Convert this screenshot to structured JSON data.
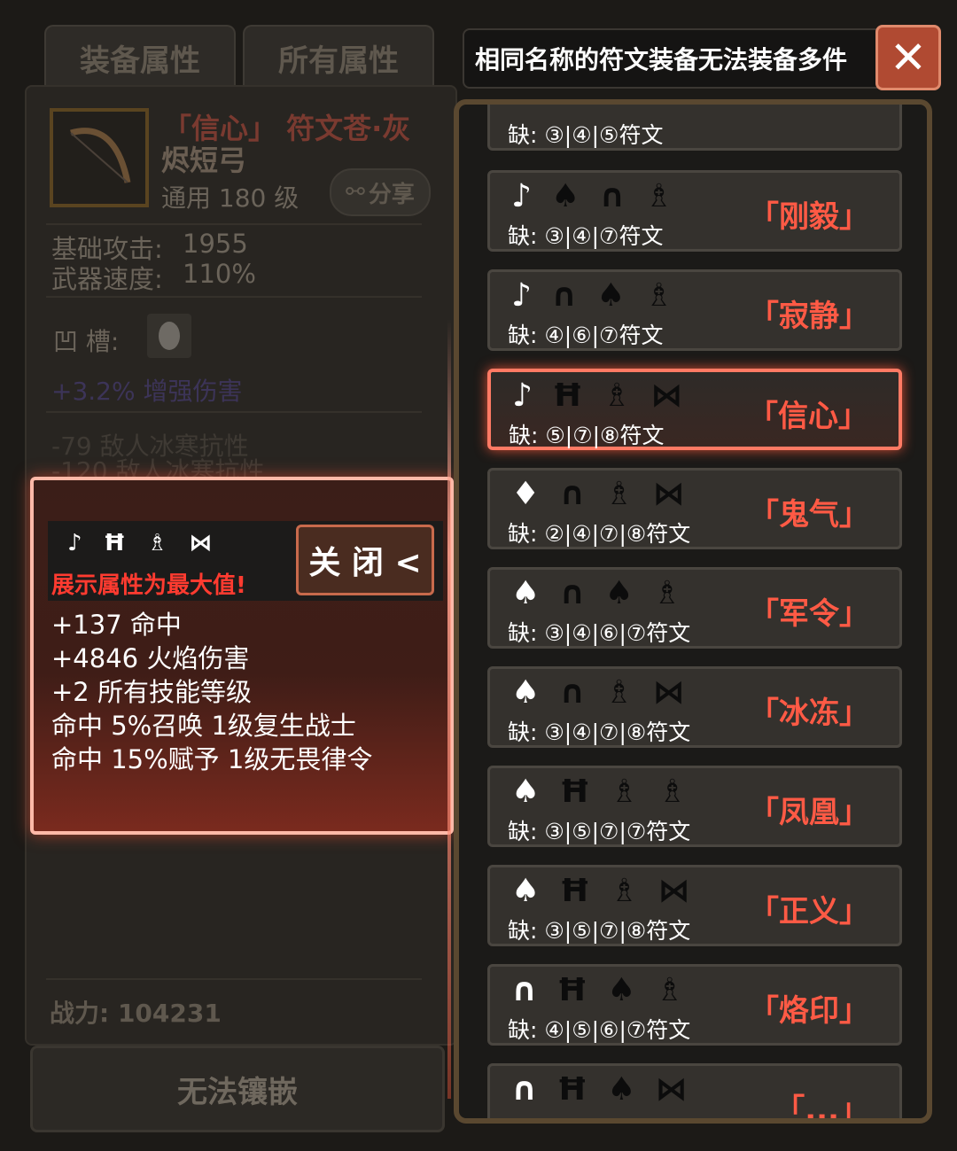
{
  "tabs": [
    {
      "label": "装备属性"
    },
    {
      "label": "所有属性"
    }
  ],
  "item": {
    "name_line1": "「信心」 符文苍·灰",
    "name_line2": "烬短弓",
    "level": "通用 180 级",
    "share_label": "分享",
    "base_attack_label": "基础攻击:",
    "base_attack_value": "1955",
    "weapon_speed_label": "武器速度:",
    "weapon_speed_value": "110%",
    "socket_label": "凹 槽:",
    "enhance": "+3.2% 增强伤害",
    "ice_resist_1": "-79 敌人冰寒抗性",
    "ice_resist_2": "-120 敌人冰寒抗性",
    "power": "战力: 104231",
    "cannot_inlay": "无法镶嵌"
  },
  "popup": {
    "runes": [
      "♪",
      "Ħ",
      "♗",
      "⋈"
    ],
    "max_note": "展示属性为最大值!",
    "close_label": "关 闭 <",
    "attributes": [
      "+137 命中",
      "+4846 火焰伤害",
      "+2 所有技能等级",
      "命中 5%召唤 1级复生战士",
      "命中 15%赋予 1级无畏律令"
    ]
  },
  "header": {
    "warning": "相同名称的符文装备无法装备多件",
    "close_icon": "✕"
  },
  "list": [
    {
      "runes": [
        "",
        "",
        "",
        ""
      ],
      "missing": "缺: ③|④|⑤符文",
      "name": "",
      "selected": false
    },
    {
      "runes": [
        "♪",
        "♠",
        "∩",
        "♗"
      ],
      "missing": "缺: ③|④|⑦符文",
      "name": "「刚毅」",
      "selected": false
    },
    {
      "runes": [
        "♪",
        "∩",
        "♠",
        "♗"
      ],
      "missing": "缺: ④|⑥|⑦符文",
      "name": "「寂静」",
      "selected": false
    },
    {
      "runes": [
        "♪",
        "Ħ",
        "♗",
        "⋈"
      ],
      "missing": "缺: ⑤|⑦|⑧符文",
      "name": "「信心」",
      "selected": true
    },
    {
      "runes": [
        "♦",
        "∩",
        "♗",
        "⋈"
      ],
      "missing": "缺: ②|④|⑦|⑧符文",
      "name": "「鬼气」",
      "selected": false
    },
    {
      "runes": [
        "♠",
        "∩",
        "♠",
        "♗"
      ],
      "missing": "缺: ③|④|⑥|⑦符文",
      "name": "「军令」",
      "selected": false
    },
    {
      "runes": [
        "♠",
        "∩",
        "♗",
        "⋈"
      ],
      "missing": "缺: ③|④|⑦|⑧符文",
      "name": "「冰冻」",
      "selected": false
    },
    {
      "runes": [
        "♠",
        "Ħ",
        "♗",
        "♗"
      ],
      "missing": "缺: ③|⑤|⑦|⑦符文",
      "name": "「凤凰」",
      "selected": false
    },
    {
      "runes": [
        "♠",
        "Ħ",
        "♗",
        "⋈"
      ],
      "missing": "缺: ③|⑤|⑦|⑧符文",
      "name": "「正义」",
      "selected": false
    },
    {
      "runes": [
        "∩",
        "Ħ",
        "♠",
        "♗"
      ],
      "missing": "缺: ④|⑤|⑥|⑦符文",
      "name": "「烙印」",
      "selected": false
    },
    {
      "runes": [
        "∩",
        "Ħ",
        "♠",
        "⋈"
      ],
      "missing": "",
      "name": "「...」",
      "selected": false
    }
  ]
}
